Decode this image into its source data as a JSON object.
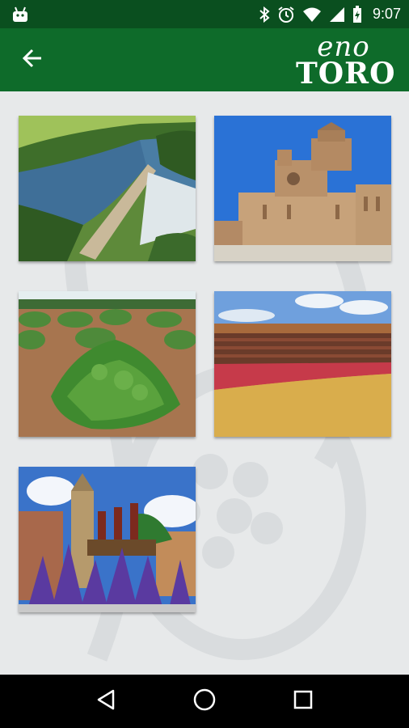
{
  "status_bar": {
    "time": "9:07",
    "icons": [
      "android-debug-icon",
      "bluetooth-icon",
      "alarm-icon",
      "wifi-icon",
      "cell-signal-icon",
      "battery-icon"
    ]
  },
  "app_bar": {
    "back_icon": "arrow-back-icon",
    "logo": {
      "line1": "eno",
      "line2": "TORO"
    },
    "colors": {
      "primary": "#0e6b2a",
      "status": "#0a4f1f"
    }
  },
  "gallery": {
    "tiles": [
      {
        "subject": "river-with-stone-bridge",
        "icon": "photo-river-bridge"
      },
      {
        "subject": "romanesque-collegiate-church",
        "icon": "photo-collegiate-church"
      },
      {
        "subject": "vineyard-rows",
        "icon": "photo-vineyard"
      },
      {
        "subject": "bullring-arena",
        "icon": "photo-bullring"
      },
      {
        "subject": "holy-week-procession",
        "icon": "photo-procession"
      }
    ]
  },
  "nav_bar": {
    "buttons": [
      "back-triangle-icon",
      "home-circle-icon",
      "recents-square-icon"
    ]
  }
}
